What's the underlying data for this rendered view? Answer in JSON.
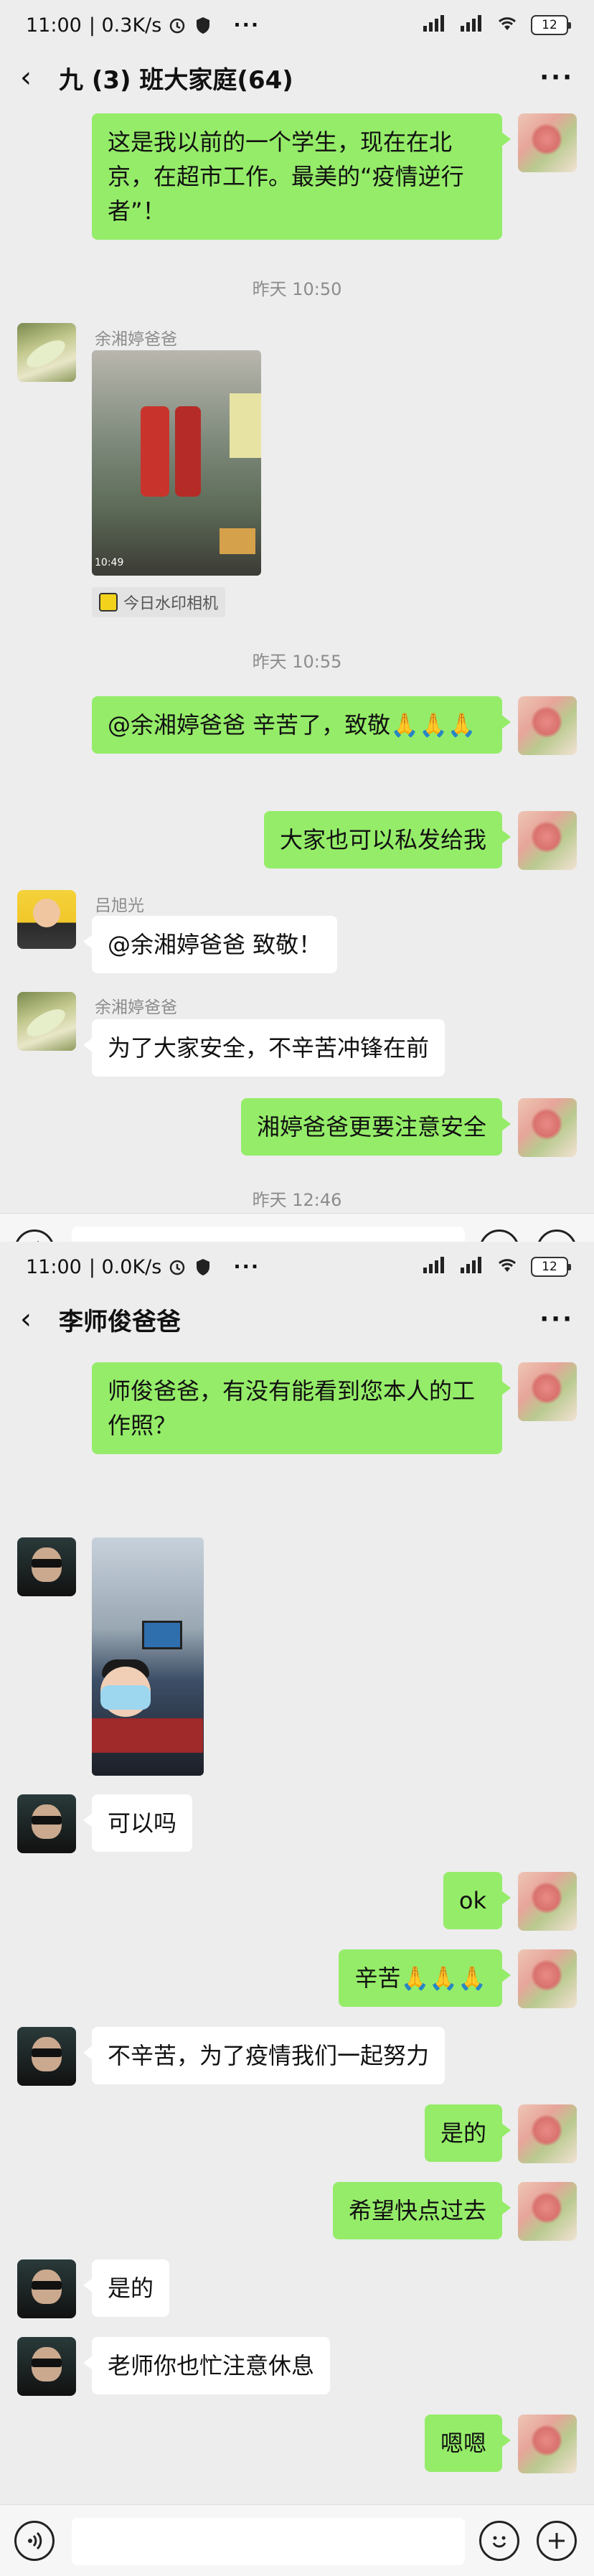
{
  "screens": [
    {
      "status": {
        "time": "11:00",
        "speed": "0.3K/s",
        "battery": "12"
      },
      "nav": {
        "title": "九 (3) 班大家庭(64)",
        "back_icon": "‹",
        "more_icon": "···"
      },
      "messages": {
        "m1": {
          "text": "这是我以前的一个学生，现在在北京，在超市工作。最美的“疫情逆行者”！"
        },
        "t1": "昨天 10:50",
        "m2": {
          "sender": "余湘婷爸爸",
          "watermark": "今日水印相机",
          "photo_stamp": "10:49"
        },
        "t2": "昨天 10:55",
        "m3": {
          "text": "@余湘婷爸爸  辛苦了，致敬🙏🙏🙏"
        },
        "m4": {
          "text": "大家也可以私发给我"
        },
        "m5": {
          "sender": "吕旭光",
          "text": "@余湘婷爸爸  致敬！"
        },
        "m6": {
          "sender": "余湘婷爸爸",
          "text": "为了大家安全，不辛苦冲锋在前"
        },
        "m7": {
          "text": "湘婷爸爸更要注意安全"
        },
        "t3": "昨天 12:46"
      }
    },
    {
      "status": {
        "time": "11:00",
        "speed": "0.0K/s",
        "battery": "12"
      },
      "nav": {
        "title": "李师俊爸爸",
        "back_icon": "‹",
        "more_icon": "···"
      },
      "messages": {
        "m1": {
          "text": "师俊爸爸，有没有能看到您本人的工作照？"
        },
        "m3": {
          "text": "可以吗"
        },
        "m4": {
          "text": "ok"
        },
        "m5": {
          "text": "辛苦🙏🙏🙏"
        },
        "m6": {
          "text": "不辛苦，为了疫情我们一起努力"
        },
        "m7": {
          "text": "是的"
        },
        "m8": {
          "text": "希望快点过去"
        },
        "m9": {
          "text": "是的"
        },
        "m10": {
          "text": "老师你也忙注意休息"
        },
        "m11": {
          "text": "嗯嗯"
        }
      }
    }
  ],
  "icons": {
    "voice": "voice-icon",
    "emoji": "emoji-icon",
    "add": "add-icon"
  },
  "colors": {
    "bubble_self": "#95ec69",
    "bubble_other": "#ffffff",
    "background": "#ededed"
  }
}
